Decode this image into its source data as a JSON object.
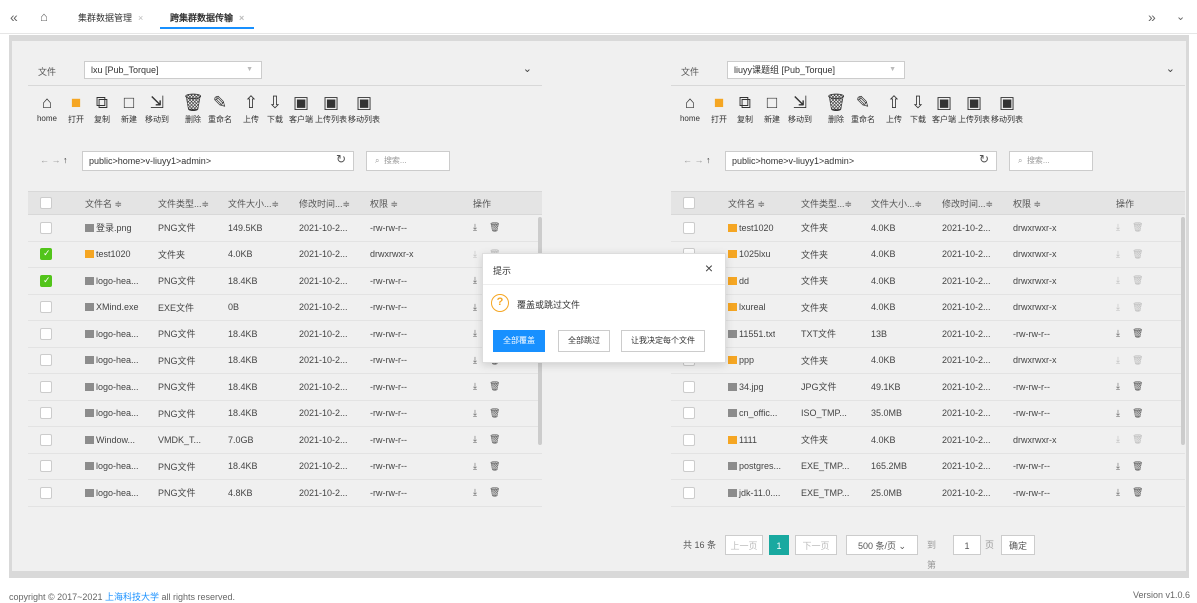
{
  "topbar": {
    "back_icon": "double-chevron-left-icon",
    "home_icon": "home-icon",
    "tabs": [
      {
        "label": "集群数据管理",
        "active": false
      },
      {
        "label": "跨集群数据传输",
        "active": true
      }
    ],
    "forward_icon": "double-chevron-right-icon",
    "menu_icon": "chevron-down-icon"
  },
  "toolbar_labels": [
    "home",
    "打开",
    "复制",
    "新建",
    "移动到",
    "删除",
    "重命名",
    "上传",
    "下载",
    "客户端",
    "上传列表",
    "移动列表"
  ],
  "table_headers": {
    "name": "文件名 ≑",
    "type": "文件类型...≑",
    "size": "文件大小...≑",
    "mtime": "修改时间...≑",
    "perm": "权限 ≑",
    "ops": "操作"
  },
  "left_panel": {
    "label": "文件",
    "cluster_select": "lxu [Pub_Torque]",
    "path": "public>home>v-liuyy1>admin>",
    "search_placeholder": "搜索...",
    "rows": [
      {
        "checked": false,
        "kind": "file",
        "name": "登录.png",
        "type": "PNG文件",
        "size": "149.5KB",
        "mtime": "2021-10-2...",
        "perm": "-rw-rw-r--"
      },
      {
        "checked": true,
        "kind": "folder",
        "name": "test1020",
        "type": "文件夹",
        "size": "4.0KB",
        "mtime": "2021-10-2...",
        "perm": "drwxrwxr-x"
      },
      {
        "checked": true,
        "kind": "file",
        "name": "logo-hea...",
        "type": "PNG文件",
        "size": "18.4KB",
        "mtime": "2021-10-2...",
        "perm": "-rw-rw-r--"
      },
      {
        "checked": false,
        "kind": "file",
        "name": "XMind.exe",
        "type": "EXE文件",
        "size": "0B",
        "mtime": "2021-10-2...",
        "perm": "-rw-rw-r--"
      },
      {
        "checked": false,
        "kind": "file",
        "name": "logo-hea...",
        "type": "PNG文件",
        "size": "18.4KB",
        "mtime": "2021-10-2...",
        "perm": "-rw-rw-r--"
      },
      {
        "checked": false,
        "kind": "file",
        "name": "logo-hea...",
        "type": "PNG文件",
        "size": "18.4KB",
        "mtime": "2021-10-2...",
        "perm": "-rw-rw-r--"
      },
      {
        "checked": false,
        "kind": "file",
        "name": "logo-hea...",
        "type": "PNG文件",
        "size": "18.4KB",
        "mtime": "2021-10-2...",
        "perm": "-rw-rw-r--"
      },
      {
        "checked": false,
        "kind": "file",
        "name": "logo-hea...",
        "type": "PNG文件",
        "size": "18.4KB",
        "mtime": "2021-10-2...",
        "perm": "-rw-rw-r--"
      },
      {
        "checked": false,
        "kind": "file",
        "name": "Window...",
        "type": "VMDK_T...",
        "size": "7.0GB",
        "mtime": "2021-10-2...",
        "perm": "-rw-rw-r--"
      },
      {
        "checked": false,
        "kind": "file",
        "name": "logo-hea...",
        "type": "PNG文件",
        "size": "18.4KB",
        "mtime": "2021-10-2...",
        "perm": "-rw-rw-r--"
      },
      {
        "checked": false,
        "kind": "file",
        "name": "logo-hea...",
        "type": "PNG文件",
        "size": "4.8KB",
        "mtime": "2021-10-2...",
        "perm": "-rw-rw-r--"
      }
    ]
  },
  "right_panel": {
    "label": "文件",
    "cluster_select": "liuyy课题组 [Pub_Torque]",
    "path": "public>home>v-liuyy1>admin>",
    "search_placeholder": "搜索...",
    "rows": [
      {
        "checked": false,
        "kind": "folder",
        "name": "test1020",
        "type": "文件夹",
        "size": "4.0KB",
        "mtime": "2021-10-2...",
        "perm": "drwxrwxr-x"
      },
      {
        "checked": false,
        "kind": "folder",
        "name": "1025lxu",
        "type": "文件夹",
        "size": "4.0KB",
        "mtime": "2021-10-2...",
        "perm": "drwxrwxr-x"
      },
      {
        "checked": false,
        "kind": "folder",
        "name": "dd",
        "type": "文件夹",
        "size": "4.0KB",
        "mtime": "2021-10-2...",
        "perm": "drwxrwxr-x"
      },
      {
        "checked": false,
        "kind": "folder",
        "name": "lxureal",
        "type": "文件夹",
        "size": "4.0KB",
        "mtime": "2021-10-2...",
        "perm": "drwxrwxr-x"
      },
      {
        "checked": false,
        "kind": "file",
        "name": "11551.txt",
        "type": "TXT文件",
        "size": "13B",
        "mtime": "2021-10-2...",
        "perm": "-rw-rw-r--"
      },
      {
        "checked": false,
        "kind": "folder",
        "name": "ppp",
        "type": "文件夹",
        "size": "4.0KB",
        "mtime": "2021-10-2...",
        "perm": "drwxrwxr-x"
      },
      {
        "checked": false,
        "kind": "file",
        "name": "34.jpg",
        "type": "JPG文件",
        "size": "49.1KB",
        "mtime": "2021-10-2...",
        "perm": "-rw-rw-r--"
      },
      {
        "checked": false,
        "kind": "file",
        "name": "cn_offic...",
        "type": "ISO_TMP...",
        "size": "35.0MB",
        "mtime": "2021-10-2...",
        "perm": "-rw-rw-r--"
      },
      {
        "checked": false,
        "kind": "folder",
        "name": "1111",
        "type": "文件夹",
        "size": "4.0KB",
        "mtime": "2021-10-2...",
        "perm": "drwxrwxr-x"
      },
      {
        "checked": false,
        "kind": "file",
        "name": "postgres...",
        "type": "EXE_TMP...",
        "size": "165.2MB",
        "mtime": "2021-10-2...",
        "perm": "-rw-rw-r--"
      },
      {
        "checked": false,
        "kind": "file",
        "name": "jdk-11.0....",
        "type": "EXE_TMP...",
        "size": "25.0MB",
        "mtime": "2021-10-2...",
        "perm": "-rw-rw-r--"
      }
    ],
    "pager": {
      "total": "共 16 条",
      "prev": "上一页",
      "current": "1",
      "next": "下一页",
      "page_size": "500 条/页",
      "goto_label": "到第",
      "goto_value": "1",
      "page_unit": "页",
      "confirm": "确定"
    }
  },
  "dialog": {
    "title": "提示",
    "message": "覆盖或跳过文件",
    "buttons": [
      "全部覆盖",
      "全部跳过",
      "让我决定每个文件"
    ]
  },
  "footer": {
    "copyright_prefix": "copyright © 2017~2021 ",
    "org_link": "上海科技大学",
    "copyright_suffix": " all rights reserved.",
    "version": "Version v1.0.6"
  },
  "colors": {
    "primary": "#1890ff",
    "checkbox_checked": "#52c41a",
    "pager_current": "#19a9a0",
    "folder": "#f5a623"
  }
}
